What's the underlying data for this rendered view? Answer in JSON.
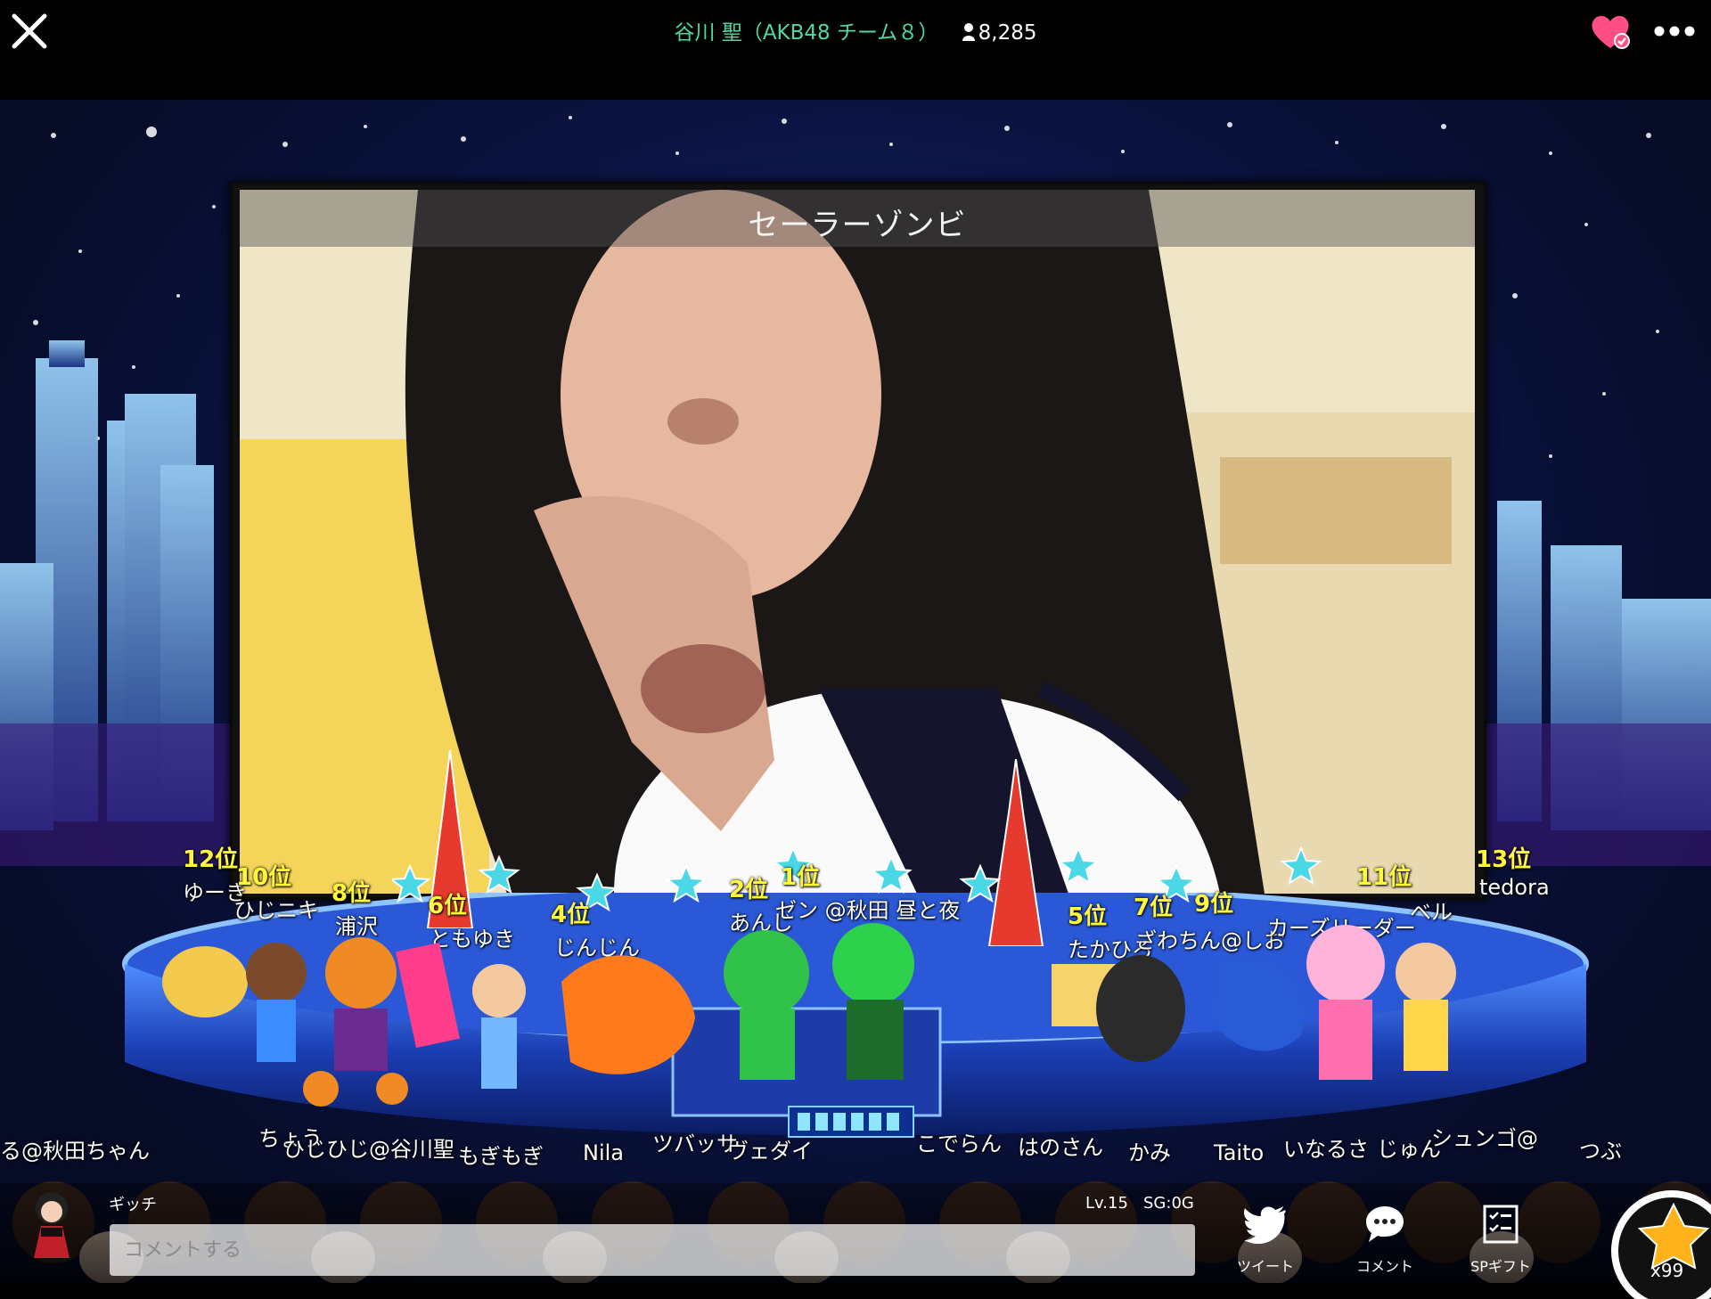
{
  "header": {
    "streamer": "谷川 聖（AKB48 チーム８）",
    "viewer_count": "8,285"
  },
  "video": {
    "title": "セーラーゾンビ"
  },
  "ranking": [
    {
      "rank": "12位",
      "name": "ゆーき"
    },
    {
      "rank": "10位",
      "name": "ひじニキ"
    },
    {
      "rank": "8位",
      "name": "浦沢"
    },
    {
      "rank": "6位",
      "name": "ともゆき"
    },
    {
      "rank": "4位",
      "name": "じんじん"
    },
    {
      "rank": "2位",
      "name": "あんじ"
    },
    {
      "rank": "1位",
      "name": "ゼン @秋田 昼と夜"
    },
    {
      "rank": "5位",
      "name": "たかひろ"
    },
    {
      "rank": "7位",
      "name": "ざわちん@しお"
    },
    {
      "rank": "9位",
      "name": "カーズリーダー"
    },
    {
      "rank": "11位",
      "name": "ベル"
    },
    {
      "rank": "13位",
      "name": "tedora"
    }
  ],
  "audience_names": [
    "る@秋田ちゃん",
    "ちょう",
    "ひじひじ@谷川聖",
    "もぎもぎ",
    "Nila",
    "ツバッサ",
    "ヴェダイ",
    "こでらん",
    "はのさん",
    "かみ",
    "Taito",
    "いなるさ",
    "じゅん",
    "シュンゴ@",
    "つぶ"
  ],
  "footer": {
    "user_name": "ギッチ",
    "level": "Lv.15",
    "sg": "SG:0G",
    "comment_placeholder": "コメントする",
    "tweet_label": "ツイート",
    "comment_label": "コメント",
    "sp_gift_label": "SPギフト",
    "star_count": "x99"
  },
  "colors": {
    "streamer_name": "#4fd9a0",
    "heart": "#ff4f86",
    "rank": "#fff83a",
    "star": "#ffb21a"
  }
}
